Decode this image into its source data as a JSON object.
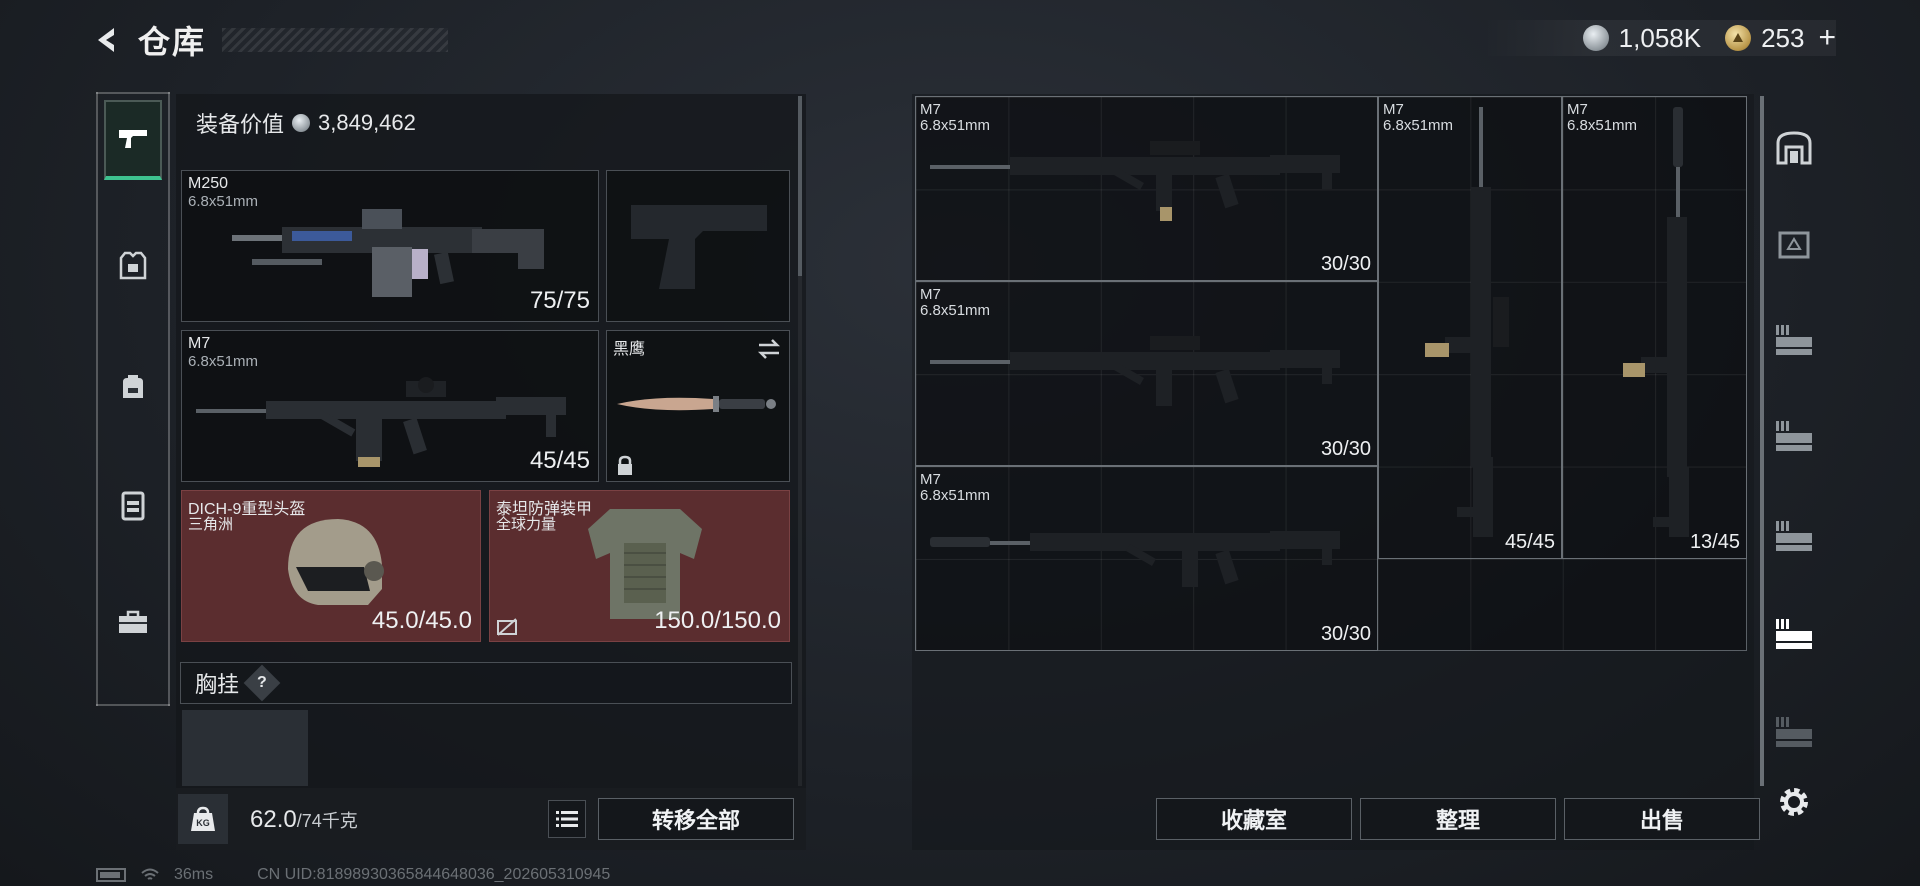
{
  "header": {
    "title": "仓库",
    "currency": [
      {
        "name": "silver",
        "value": "1,058K"
      },
      {
        "name": "gold",
        "value": "253"
      }
    ],
    "plus_label": "+"
  },
  "left_nav": {
    "items": [
      {
        "icon": "pistol-icon",
        "active": true
      },
      {
        "icon": "armor-icon",
        "active": false
      },
      {
        "icon": "backpack-icon",
        "active": false
      },
      {
        "icon": "vest-icon",
        "active": false
      },
      {
        "icon": "toolbox-icon",
        "active": false
      }
    ]
  },
  "equipment": {
    "value_label": "装备价值",
    "value": "3,849,462",
    "primary": {
      "name": "M250",
      "caliber": "6.8x51mm",
      "ammo": "75/75"
    },
    "secondary": {
      "name": "M7",
      "caliber": "6.8x51mm",
      "ammo": "45/45"
    },
    "melee": {
      "name": "黑鹰"
    },
    "helmet": {
      "name": "DICH-9重型头盔",
      "sub": "三角洲",
      "durability": "45.0/45.0"
    },
    "armor": {
      "name": "泰坦防弹装甲",
      "sub": "全球力量",
      "durability": "150.0/150.0"
    },
    "chest_label": "胸挂",
    "help_label": "?"
  },
  "bottom_left": {
    "weight": "62.0",
    "capacity": "/74千克",
    "kg_label": "KG",
    "transfer_all": "转移全部"
  },
  "storage": {
    "items": [
      {
        "name": "M7",
        "caliber": "6.8x51mm",
        "ammo": "30/30"
      },
      {
        "name": "M7",
        "caliber": "6.8x51mm",
        "ammo": "30/30"
      },
      {
        "name": "M7",
        "caliber": "6.8x51mm",
        "ammo": "30/30"
      },
      {
        "name": "M7",
        "caliber": "6.8x51mm",
        "ammo": "45/45"
      },
      {
        "name": "M7",
        "caliber": "6.8x51mm",
        "ammo": "13/45"
      }
    ],
    "buttons": {
      "collection": "收藏室",
      "sort": "整理",
      "sell": "出售"
    }
  },
  "status": {
    "ping": "36ms",
    "uid": "CN UID:8189893036584464803​6_202605310945"
  },
  "colors": {
    "accent": "#3ec28f",
    "red_slot": "#5b2d2f"
  }
}
